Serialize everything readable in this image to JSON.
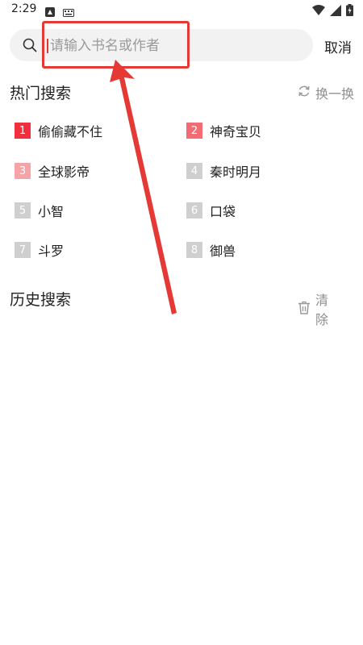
{
  "status_bar": {
    "time": "2:29",
    "left_icons": [
      "app-notification-icon",
      "keyboard-icon"
    ],
    "right_icons": [
      "wifi-icon",
      "signal-icon",
      "battery-charging-icon"
    ]
  },
  "search": {
    "placeholder": "请输入书名或作者",
    "value": "",
    "cancel_label": "取消"
  },
  "hot_search": {
    "title": "热门搜索",
    "refresh_label": "换一换",
    "items": [
      {
        "rank": "1",
        "label": "偷偷藏不住",
        "badge_color": "#f2303d"
      },
      {
        "rank": "2",
        "label": "神奇宝贝",
        "badge_color": "#f36c73"
      },
      {
        "rank": "3",
        "label": "全球影帝",
        "badge_color": "#f6a3a8"
      },
      {
        "rank": "4",
        "label": "秦时明月",
        "badge_color": "#cfcfcf"
      },
      {
        "rank": "5",
        "label": "小智",
        "badge_color": "#cfcfcf"
      },
      {
        "rank": "6",
        "label": "口袋",
        "badge_color": "#cfcfcf"
      },
      {
        "rank": "7",
        "label": "斗罗",
        "badge_color": "#cfcfcf"
      },
      {
        "rank": "8",
        "label": "御兽",
        "badge_color": "#cfcfcf"
      }
    ]
  },
  "history_search": {
    "title": "历史搜索",
    "clear_label": "清除"
  },
  "colors": {
    "accent": "#e53935",
    "muted_text": "#8e8e8e",
    "search_bg": "#f2f2f2"
  }
}
